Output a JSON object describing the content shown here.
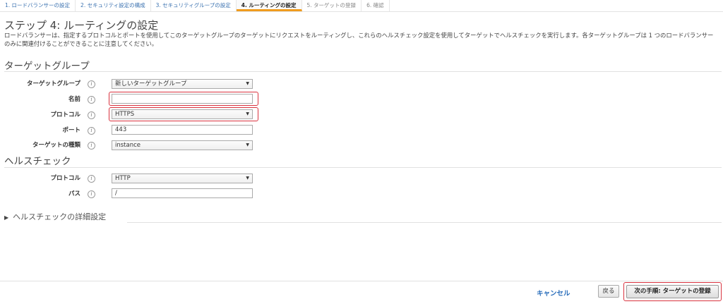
{
  "wizard": {
    "steps": [
      {
        "label": "1. ロードバランサーの設定"
      },
      {
        "label": "2. セキュリティ設定の構成"
      },
      {
        "label": "3. セキュリティグループの設定"
      },
      {
        "label": "4. ルーティングの設定"
      },
      {
        "label": "5. ターゲットの登録"
      },
      {
        "label": "6. 確認"
      }
    ],
    "active_step": 4
  },
  "page": {
    "title": "ステップ 4: ルーティングの設定",
    "description": "ロードバランサーは、指定するプロトコルとポートを使用してこのターゲットグループのターゲットにリクエストをルーティングし、これらのヘルスチェック設定を使用してターゲットでヘルスチェックを実行します。各ターゲットグループは 1 つのロードバランサーのみに関連付けることができることに注意してください。"
  },
  "target_group": {
    "heading": "ターゲットグループ",
    "fields": {
      "target_group": {
        "label": "ターゲットグループ",
        "value": "新しいターゲットグループ"
      },
      "name": {
        "label": "名前",
        "value": ""
      },
      "protocol": {
        "label": "プロトコル",
        "value": "HTTPS"
      },
      "port": {
        "label": "ポート",
        "value": "443"
      },
      "target_type": {
        "label": "ターゲットの種類",
        "value": "instance"
      }
    }
  },
  "health_check": {
    "heading": "ヘルスチェック",
    "fields": {
      "protocol": {
        "label": "プロトコル",
        "value": "HTTP"
      },
      "path": {
        "label": "パス",
        "value": "/"
      }
    },
    "advanced_label": "ヘルスチェックの詳細設定"
  },
  "footer": {
    "cancel_label": "キャンセル",
    "back_label": "戻る",
    "next_label": "次の手順: ターゲットの登録"
  },
  "icons": {
    "info": "i",
    "caret": "▼",
    "expand": "▶"
  },
  "colors": {
    "link": "#2a6ebb",
    "highlight": "#d9333f",
    "active_step_bar": "#f09c1e"
  }
}
